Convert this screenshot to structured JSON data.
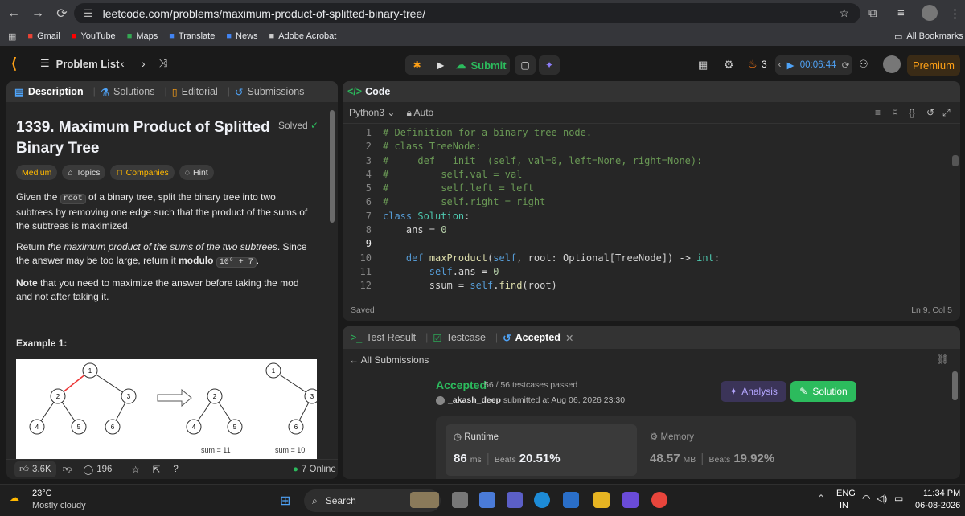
{
  "browser": {
    "url": "leetcode.com/problems/maximum-product-of-splitted-binary-tree/",
    "all_bookmarks": "All Bookmarks"
  },
  "bookmarks": [
    {
      "label": "Gmail",
      "color": "#ea4335"
    },
    {
      "label": "YouTube",
      "color": "#ff0000"
    },
    {
      "label": "Maps",
      "color": "#34a853"
    },
    {
      "label": "Translate",
      "color": "#4285f4"
    },
    {
      "label": "News",
      "color": "#4285f4"
    },
    {
      "label": "Adobe Acrobat",
      "color": "#cccccc"
    }
  ],
  "nav": {
    "problem_list": "Problem List",
    "submit": "Submit",
    "streak": "3",
    "timer": "00:06:44",
    "premium": "Premium"
  },
  "left_tabs": {
    "description": "Description",
    "solutions": "Solutions",
    "editorial": "Editorial",
    "submissions": "Submissions"
  },
  "problem": {
    "title": "1339. Maximum Product of Splitted Binary Tree",
    "status": "Solved",
    "difficulty": "Medium",
    "topics": "Topics",
    "companies": "Companies",
    "hint": "Hint",
    "p1_a": "Given the ",
    "p1_code": "root",
    "p1_b": " of a binary tree, split the binary tree into two subtrees by removing one edge such that the product of the sums of the subtrees is maximized.",
    "p2_a": "Return ",
    "p2_em": "the maximum product of the sums of the two subtrees",
    "p2_b": ". Since the answer may be too large, return it ",
    "p2_strong": "modulo",
    "p2_code": "10⁹ + 7",
    "p3_strong": "Note",
    "p3_b": " that you need to maximize the answer before taking the mod and not after taking it.",
    "example_title": "Example 1:",
    "sum_left": "sum = 11",
    "sum_right": "sum = 10",
    "tree_left": [
      "1",
      "2",
      "3",
      "4",
      "5",
      "6"
    ],
    "tree_right": [
      "2",
      "4",
      "5",
      "1",
      "3",
      "6"
    ]
  },
  "footer": {
    "likes": "3.6K",
    "comments": "196",
    "online": "7 Online"
  },
  "code": {
    "header": "Code",
    "language": "Python3",
    "mode": "Auto",
    "saved": "Saved",
    "cursor": "Ln 9, Col 5",
    "lines": [
      {
        "n": "1",
        "t": [
          [
            "cm",
            "# Definition for a binary tree node."
          ]
        ]
      },
      {
        "n": "2",
        "t": [
          [
            "cm",
            "# class TreeNode:"
          ]
        ]
      },
      {
        "n": "3",
        "t": [
          [
            "cm",
            "#     def __init__(self, val=0, left=None, right=None):"
          ]
        ]
      },
      {
        "n": "4",
        "t": [
          [
            "cm",
            "#         self.val = val"
          ]
        ]
      },
      {
        "n": "5",
        "t": [
          [
            "cm",
            "#         self.left = left"
          ]
        ]
      },
      {
        "n": "6",
        "t": [
          [
            "cm",
            "#         self.right = right"
          ]
        ]
      },
      {
        "n": "7",
        "t": [
          [
            "kw",
            "class "
          ],
          [
            "cls",
            "Solution"
          ],
          [
            "tx",
            ":"
          ]
        ]
      },
      {
        "n": "8",
        "t": [
          [
            "tx",
            "    ans = "
          ],
          [
            "num",
            "0"
          ]
        ]
      },
      {
        "n": "9",
        "t": [
          [
            "tx",
            ""
          ]
        ]
      },
      {
        "n": "10",
        "t": [
          [
            "tx",
            "    "
          ],
          [
            "kw",
            "def "
          ],
          [
            "fn",
            "maxProduct"
          ],
          [
            "tx",
            "("
          ],
          [
            "kw",
            "self"
          ],
          [
            "tx",
            ", root: Optional[TreeNode]) -> "
          ],
          [
            "cls",
            "int"
          ],
          [
            "tx",
            ":"
          ]
        ]
      },
      {
        "n": "11",
        "t": [
          [
            "tx",
            "        "
          ],
          [
            "kw",
            "self"
          ],
          [
            "tx",
            ".ans = "
          ],
          [
            "num",
            "0"
          ]
        ]
      },
      {
        "n": "12",
        "t": [
          [
            "tx",
            "        ssum = "
          ],
          [
            "kw",
            "self"
          ],
          [
            "tx",
            "."
          ],
          [
            "fn",
            "find"
          ],
          [
            "tx",
            "(root)"
          ]
        ]
      }
    ]
  },
  "result": {
    "test_result": "Test Result",
    "testcase": "Testcase",
    "accepted_tab": "Accepted",
    "all_submissions": "All Submissions",
    "status": "Accepted",
    "passed": "56 / 56 testcases passed",
    "user": "_akash_deep",
    "submitted": " submitted at Aug 06, 2026 23:30",
    "analysis": "Analysis",
    "solution": "Solution",
    "runtime_label": "Runtime",
    "runtime_value": "86",
    "runtime_unit": "ms",
    "runtime_beats_label": "Beats",
    "runtime_beats": "20.51%",
    "memory_label": "Memory",
    "memory_value": "48.57",
    "memory_unit": "MB",
    "memory_beats_label": "Beats",
    "memory_beats": "19.92%"
  },
  "taskbar": {
    "temp": "23°C",
    "weather": "Mostly cloudy",
    "search": "Search",
    "lang1": "ENG",
    "lang2": "IN",
    "time": "11:34 PM",
    "date": "06-08-2026"
  },
  "colors": {
    "accent_green": "#2cbb5d",
    "brand_orange": "#ffa116",
    "medium": "#ffb800",
    "link_blue": "#4fa3f7"
  }
}
